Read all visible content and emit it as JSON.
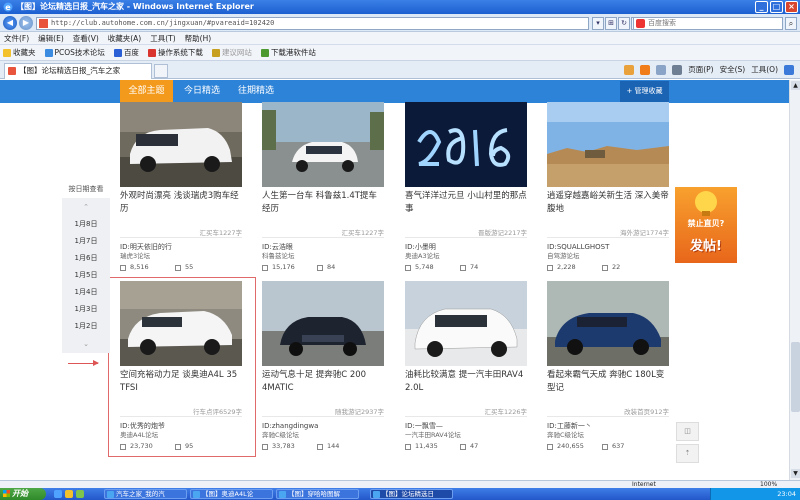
{
  "window": {
    "title": "【图】论坛精选日报_汽车之家 - Windows Internet Explorer",
    "controls": [
      "_",
      "□",
      "×"
    ]
  },
  "address": {
    "url": "http://club.autohome.com.cn/jingxuan/#pvareaid=102420",
    "search_placeholder": "百度搜索"
  },
  "menu": [
    "文件(F)",
    "编辑(E)",
    "查看(V)",
    "收藏夹(A)",
    "工具(T)",
    "帮助(H)"
  ],
  "favorites": [
    {
      "label": "收藏夹",
      "color": "#f3c12b",
      "dim": false
    },
    {
      "label": "PCOS技术论坛",
      "color": "#3b8ce0",
      "dim": false
    },
    {
      "label": "百度",
      "color": "#2b5fd6",
      "dim": false
    },
    {
      "label": "操作系统下载",
      "color": "#d9352e",
      "dim": false
    },
    {
      "label": "建议网站",
      "color": "#c8a020",
      "dim": true
    },
    {
      "label": "下载港软件站",
      "color": "#4c9a2f",
      "dim": false
    }
  ],
  "browser_tab": {
    "label": "【图】论坛精选日报_汽车之家"
  },
  "command_bar": {
    "page": "页面(P)",
    "safety": "安全(S)",
    "tools": "工具(O)"
  },
  "nav": {
    "tabs": [
      "全部主题",
      "今日精选",
      "往期精选"
    ],
    "manage": "+ 管理收藏"
  },
  "dates": {
    "heading": "按日期查看",
    "items": [
      "1月8日",
      "1月7日",
      "1月6日",
      "1月5日",
      "1月4日",
      "1月3日",
      "1月2日"
    ]
  },
  "cards": [
    {
      "title": "外观时尚漂亮 浅谈瑞虎3购车经历",
      "source": "汇买车1227字",
      "uid": "ID:明天依旧的行",
      "forum": "瑞虎3论坛",
      "views": "8,516",
      "replies": "55"
    },
    {
      "title": "人生第一台车 科鲁兹1.4T提车经历",
      "source": "汇买车1227字",
      "uid": "ID:云浩眼",
      "forum": "科鲁兹论坛",
      "views": "15,176",
      "replies": "84"
    },
    {
      "title": "喜气洋洋过元旦 小山村里的那点事",
      "source": "晋版游记2217字",
      "uid": "ID:小墨明",
      "forum": "奥迪A3论坛",
      "views": "5,748",
      "replies": "74"
    },
    {
      "title": "逍遥穿越嘉峪关新生活 深入美帝腹地",
      "source": "海外游记1774字",
      "uid": "ID:SQUALLGHOST",
      "forum": "自驾游论坛",
      "views": "2,228",
      "replies": "22"
    },
    {
      "title": "空间充裕动力足 谈奥迪A4L 35 TFSI",
      "source": "行车点评6529字",
      "uid": "ID:优秀的炮爷",
      "forum": "奥迪A4L论坛",
      "views": "23,730",
      "replies": "95"
    },
    {
      "title": "运动气息十足 提奔驰C 200 4MATIC",
      "source": "随我游记2937字",
      "uid": "ID:zhangdingwa",
      "forum": "奔驰C级论坛",
      "views": "33,783",
      "replies": "144"
    },
    {
      "title": "油耗比较满意 提一汽丰田RAV4 2.0L",
      "source": "汇买车1226字",
      "uid": "ID:一飘雪—",
      "forum": "一汽丰田RAV4论坛",
      "views": "11,435",
      "replies": "47"
    },
    {
      "title": "看起来霸气天成 奔驰C 180L变型记",
      "source": "改装首页912字",
      "uid": "ID:工藤新一丶",
      "forum": "奔驰C级论坛",
      "views": "240,655",
      "replies": "637"
    }
  ],
  "ad": {
    "line1": "禁止直贝?",
    "line2": "发帖!"
  },
  "status": {
    "zone": "Internet",
    "zoom": "100%"
  },
  "taskbar": {
    "start": "开始",
    "tasks": [
      "汽车之家_我的汽",
      "【图】奥迪A4L论",
      "【图】穿哈哈图解",
      "【图】论坛精选日"
    ],
    "time": "23:04"
  }
}
